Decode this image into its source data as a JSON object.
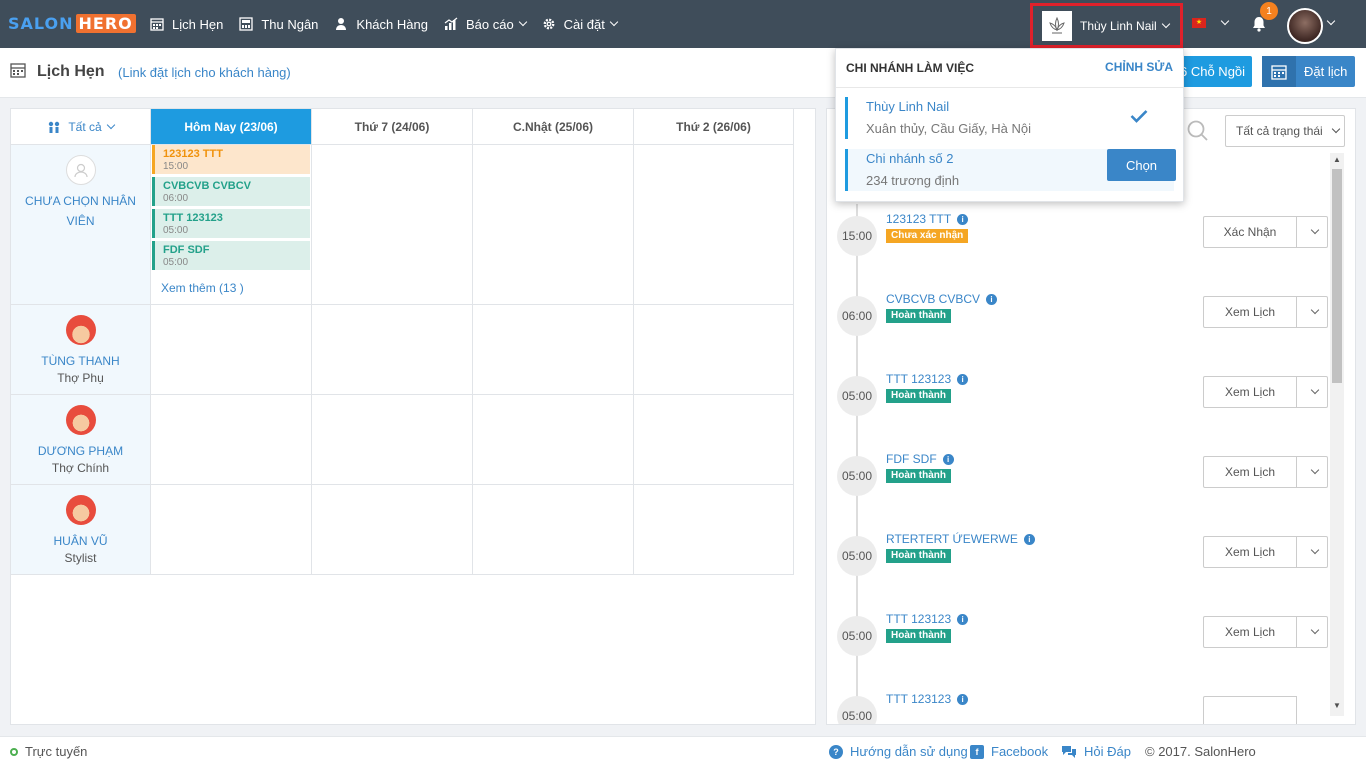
{
  "brand": {
    "part1": "SALON",
    "part2": "HERO"
  },
  "nav": [
    {
      "label": "Lịch Hẹn",
      "icon": "calendar-icon"
    },
    {
      "label": "Thu Ngân",
      "icon": "cashier-icon"
    },
    {
      "label": "Khách Hàng",
      "icon": "user-icon"
    },
    {
      "label": "Báo cáo",
      "icon": "chart-icon"
    },
    {
      "label": "Cài đặt",
      "icon": "gear-icon"
    }
  ],
  "branch": {
    "current": "Thùy Linh Nail"
  },
  "notifications": {
    "count": "1"
  },
  "page": {
    "title": "Lịch Hẹn",
    "link_open": "(",
    "link_text": "Link đặt lịch cho khách hàng",
    "link_close": ")"
  },
  "buttons": {
    "seats": "6 Chỗ Ngồi",
    "book": "Đặt lịch"
  },
  "calendar": {
    "filter_label": "Tất cả",
    "columns": [
      "Hôm Nay (23/06)",
      "Thứ 7 (24/06)",
      "C.Nhật (25/06)",
      "Thứ 2 (26/06)"
    ],
    "staff": [
      {
        "name": "CHƯA CHỌN NHÂN VIÊN",
        "role": ""
      },
      {
        "name": "TÙNG THANH",
        "role": "Thợ Phụ"
      },
      {
        "name": "DƯƠNG PHẠM",
        "role": "Thợ Chính"
      },
      {
        "name": "HUÂN VŨ",
        "role": "Stylist"
      }
    ],
    "appointments": [
      {
        "name": "123123 TTT",
        "time": "15:00",
        "status": "orange"
      },
      {
        "name": "CVBCVB CVBCV",
        "time": "06:00",
        "status": "green"
      },
      {
        "name": "TTT 123123",
        "time": "05:00",
        "status": "green"
      },
      {
        "name": "FDF SDF",
        "time": "05:00",
        "status": "green"
      }
    ],
    "more": "Xem thêm (13 )"
  },
  "timeline": {
    "status_filter": "Tất cả trạng thái",
    "items": [
      {
        "time": "15:00",
        "name": "123123 TTT",
        "badge": "Chưa xác nhận",
        "badge_color": "orange",
        "action": "Xác Nhận"
      },
      {
        "time": "06:00",
        "name": "CVBCVB CVBCV",
        "badge": "Hoàn thành",
        "badge_color": "green",
        "action": "Xem Lịch"
      },
      {
        "time": "05:00",
        "name": "TTT 123123",
        "badge": "Hoàn thành",
        "badge_color": "green",
        "action": "Xem Lịch"
      },
      {
        "time": "05:00",
        "name": "FDF SDF",
        "badge": "Hoàn thành",
        "badge_color": "green",
        "action": "Xem Lịch"
      },
      {
        "time": "05:00",
        "name": "RTERTERT ỨEWERWE",
        "badge": "Hoàn thành",
        "badge_color": "green",
        "action": "Xem Lịch"
      },
      {
        "time": "05:00",
        "name": "TTT 123123",
        "badge": "Hoàn thành",
        "badge_color": "green",
        "action": "Xem Lịch"
      },
      {
        "time": "05:00",
        "name": "TTT 123123",
        "badge": "",
        "badge_color": "green",
        "action": ""
      }
    ]
  },
  "branch_dropdown": {
    "heading": "CHI NHÁNH LÀM VIỆC",
    "edit": "CHỈNH SỬA",
    "branches": [
      {
        "name": "Thùy Linh Nail",
        "address": "Xuân thủy, Cầu Giấy, Hà Nội",
        "selected": true
      },
      {
        "name": "Chi nhánh số 2",
        "address": "234 trương định",
        "selected": false
      }
    ],
    "choose_label": "Chọn"
  },
  "footer": {
    "status": "Trực tuyến",
    "help": "Hướng dẫn sử dụng",
    "facebook": "Facebook",
    "qa": "Hỏi Đáp",
    "copyright": "© 2017. SalonHero"
  },
  "colors": {
    "topbar": "#3f4d5a",
    "primary": "#1e9be0",
    "link": "#3a86c8",
    "orange": "#f5a623",
    "green": "#23a18a",
    "highlight": "#e0212b"
  }
}
